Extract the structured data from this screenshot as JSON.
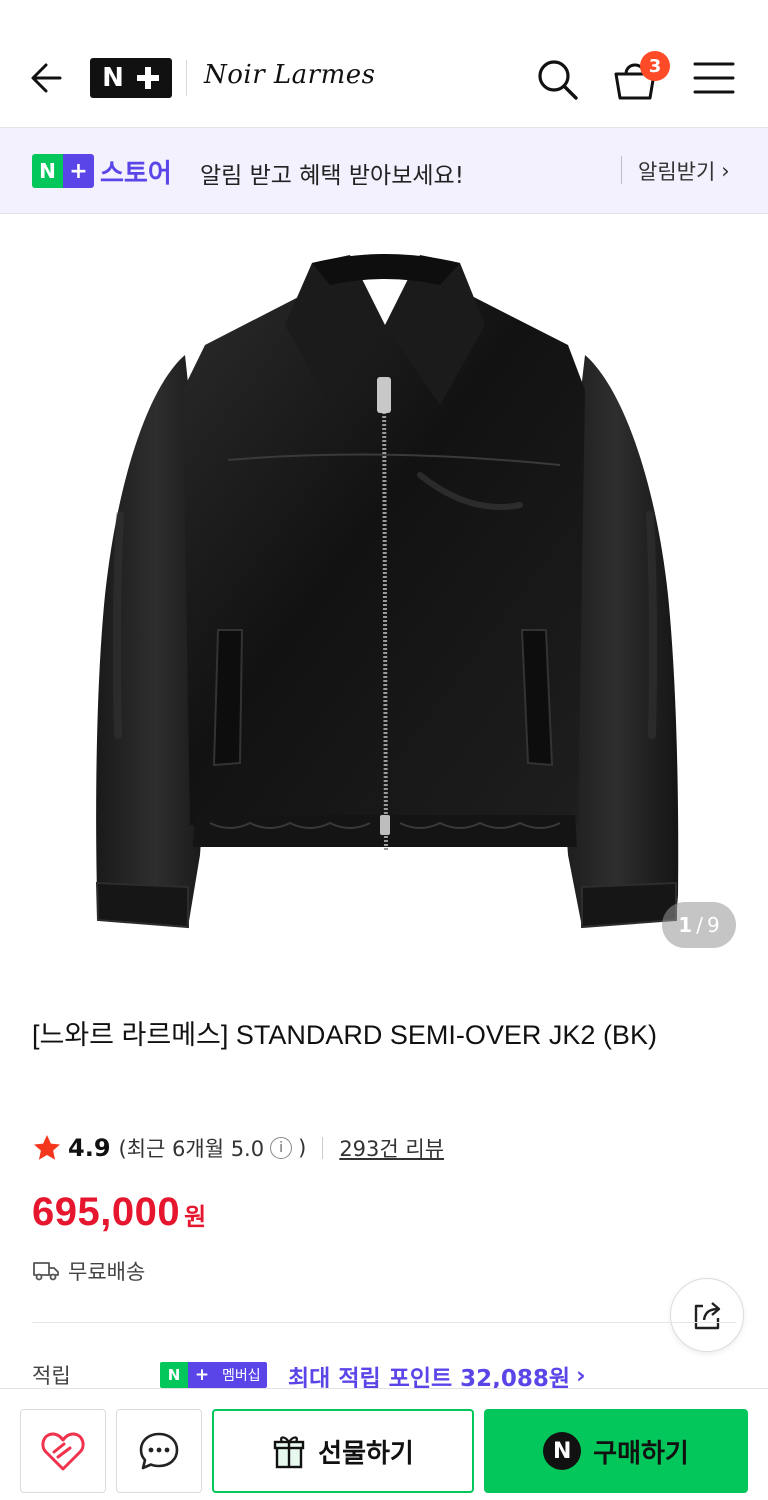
{
  "header": {
    "logo_text": "N+",
    "brand": "Noir Larmes",
    "cart_count": "3",
    "icons": [
      "back-arrow-icon",
      "search-icon",
      "cart-icon",
      "menu-icon"
    ]
  },
  "banner": {
    "badge_n": "N",
    "badge_plus": "+",
    "store_label": "스토어",
    "text": "알림 받고 혜택 받아보세요!",
    "link": "알림받기",
    "link_arrow": "›"
  },
  "gallery": {
    "current": "1",
    "separator": "/",
    "total": "9"
  },
  "product": {
    "title": "[느와르 라르메스] STANDARD SEMI-OVER JK2 (BK)",
    "rating": "4.9",
    "recent_open": "(최근 6개월 5.0",
    "recent_close": ")",
    "info_glyph": "i",
    "review_count": "293건 리뷰",
    "price": "695,000",
    "price_unit": "원",
    "shipping": "무료배송"
  },
  "points": {
    "label": "적립",
    "badge_n": "N",
    "badge_plus": "+",
    "badge_text": "멤버십",
    "text": "최대 적립 포인트 32,088원",
    "arrow": "›"
  },
  "bottom_bar": {
    "gift_label": "선물하기",
    "buy_label": "구매하기",
    "buy_badge": "N"
  },
  "colors": {
    "naver_green": "#03c75a",
    "plus_purple": "#5a46e8",
    "price_red": "#e5162d",
    "badge_orange": "#ff4b27",
    "banner_bg": "#f3f1fd"
  }
}
